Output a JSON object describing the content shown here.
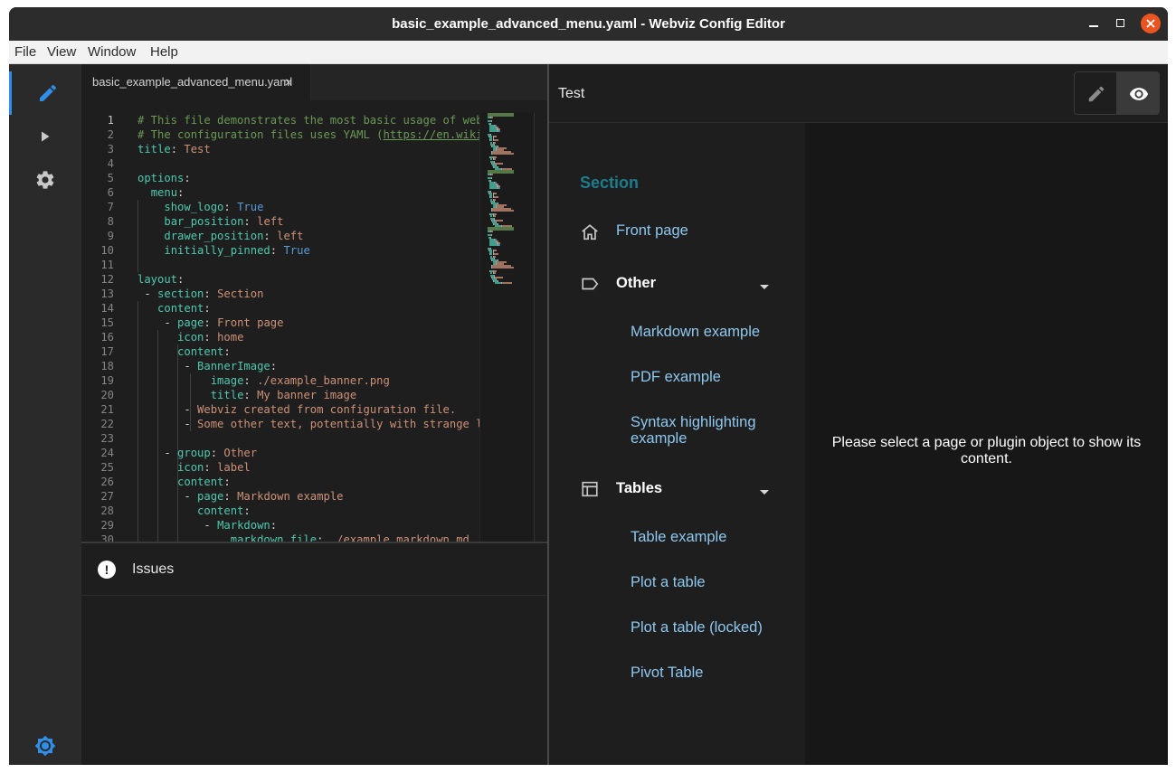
{
  "window": {
    "title": "basic_example_advanced_menu.yaml - Webviz Config Editor"
  },
  "menubar": {
    "items": [
      "File",
      "View",
      "Window",
      "Help"
    ]
  },
  "activity_bar": {
    "items": [
      {
        "name": "editor",
        "icon": "pencil-icon",
        "active": true
      },
      {
        "name": "play",
        "icon": "play-icon",
        "active": false
      },
      {
        "name": "settings",
        "icon": "gear-icon",
        "active": false
      },
      {
        "name": "theme",
        "icon": "brightness-icon",
        "active": false
      }
    ]
  },
  "editor": {
    "tab": {
      "label": "basic_example_advanced_menu.yaml",
      "close": "×"
    },
    "current_line": 1,
    "lines": [
      {
        "n": "1",
        "parts": [
          [
            "c",
            "# This file demonstrates the most basic usage of webv"
          ]
        ]
      },
      {
        "n": "2",
        "parts": [
          [
            "c",
            "# The configuration files uses YAML (https://en.wiki"
          ]
        ]
      },
      {
        "n": "3",
        "parts": [
          [
            "k",
            "title"
          ],
          [
            "p",
            ": "
          ],
          [
            "v",
            "Test"
          ]
        ]
      },
      {
        "n": "4",
        "parts": []
      },
      {
        "n": "5",
        "parts": [
          [
            "k",
            "options"
          ],
          [
            "p",
            ":"
          ]
        ]
      },
      {
        "n": "6",
        "parts": [
          [
            "p",
            "  "
          ],
          [
            "k",
            "menu"
          ],
          [
            "p",
            ":"
          ]
        ]
      },
      {
        "n": "7",
        "parts": [
          [
            "p",
            "    "
          ],
          [
            "k",
            "show_logo"
          ],
          [
            "p",
            ": "
          ],
          [
            "b",
            "True"
          ]
        ]
      },
      {
        "n": "8",
        "parts": [
          [
            "p",
            "    "
          ],
          [
            "k",
            "bar_position"
          ],
          [
            "p",
            ": "
          ],
          [
            "v",
            "left"
          ]
        ]
      },
      {
        "n": "9",
        "parts": [
          [
            "p",
            "    "
          ],
          [
            "k",
            "drawer_position"
          ],
          [
            "p",
            ": "
          ],
          [
            "v",
            "left"
          ]
        ]
      },
      {
        "n": "10",
        "parts": [
          [
            "p",
            "    "
          ],
          [
            "k",
            "initially_pinned"
          ],
          [
            "p",
            ": "
          ],
          [
            "b",
            "True"
          ]
        ]
      },
      {
        "n": "11",
        "parts": []
      },
      {
        "n": "12",
        "parts": [
          [
            "k",
            "layout"
          ],
          [
            "p",
            ":"
          ]
        ]
      },
      {
        "n": "13",
        "parts": [
          [
            "p",
            " - "
          ],
          [
            "k",
            "section"
          ],
          [
            "p",
            ": "
          ],
          [
            "v",
            "Section"
          ]
        ]
      },
      {
        "n": "14",
        "parts": [
          [
            "p",
            "   "
          ],
          [
            "k",
            "content"
          ],
          [
            "p",
            ":"
          ]
        ]
      },
      {
        "n": "15",
        "parts": [
          [
            "p",
            "    - "
          ],
          [
            "k",
            "page"
          ],
          [
            "p",
            ": "
          ],
          [
            "v",
            "Front page"
          ]
        ]
      },
      {
        "n": "16",
        "parts": [
          [
            "p",
            "      "
          ],
          [
            "k",
            "icon"
          ],
          [
            "p",
            ": "
          ],
          [
            "v",
            "home"
          ]
        ]
      },
      {
        "n": "17",
        "parts": [
          [
            "p",
            "      "
          ],
          [
            "k",
            "content"
          ],
          [
            "p",
            ":"
          ]
        ]
      },
      {
        "n": "18",
        "parts": [
          [
            "p",
            "       - "
          ],
          [
            "k",
            "BannerImage"
          ],
          [
            "p",
            ":"
          ]
        ]
      },
      {
        "n": "19",
        "parts": [
          [
            "p",
            "           "
          ],
          [
            "k",
            "image"
          ],
          [
            "p",
            ": "
          ],
          [
            "v",
            "./example_banner.png"
          ]
        ]
      },
      {
        "n": "20",
        "parts": [
          [
            "p",
            "           "
          ],
          [
            "k",
            "title"
          ],
          [
            "p",
            ": "
          ],
          [
            "v",
            "My banner image"
          ]
        ]
      },
      {
        "n": "21",
        "parts": [
          [
            "p",
            "       - "
          ],
          [
            "v",
            "Webviz created from configuration file."
          ]
        ]
      },
      {
        "n": "22",
        "parts": [
          [
            "p",
            "       - "
          ],
          [
            "v",
            "Some other text, potentially with strange le"
          ]
        ]
      },
      {
        "n": "23",
        "parts": []
      },
      {
        "n": "24",
        "parts": [
          [
            "p",
            "    - "
          ],
          [
            "k",
            "group"
          ],
          [
            "p",
            ": "
          ],
          [
            "v",
            "Other"
          ]
        ]
      },
      {
        "n": "25",
        "parts": [
          [
            "p",
            "      "
          ],
          [
            "k",
            "icon"
          ],
          [
            "p",
            ": "
          ],
          [
            "v",
            "label"
          ]
        ]
      },
      {
        "n": "26",
        "parts": [
          [
            "p",
            "      "
          ],
          [
            "k",
            "content"
          ],
          [
            "p",
            ":"
          ]
        ]
      },
      {
        "n": "27",
        "parts": [
          [
            "p",
            "       - "
          ],
          [
            "k",
            "page"
          ],
          [
            "p",
            ": "
          ],
          [
            "v",
            "Markdown example"
          ]
        ]
      },
      {
        "n": "28",
        "parts": [
          [
            "p",
            "         "
          ],
          [
            "k",
            "content"
          ],
          [
            "p",
            ":"
          ]
        ]
      },
      {
        "n": "29",
        "parts": [
          [
            "p",
            "          - "
          ],
          [
            "k",
            "Markdown"
          ],
          [
            "p",
            ":"
          ]
        ]
      },
      {
        "n": "30",
        "parts": [
          [
            "p",
            "              "
          ],
          [
            "k",
            "markdown_file"
          ],
          [
            "p",
            ": "
          ],
          [
            "v",
            "./example_markdown.md"
          ]
        ]
      }
    ]
  },
  "issues": {
    "icon": "!",
    "label": "Issues"
  },
  "preview": {
    "title": "Test",
    "edit_icon": "pencil-icon",
    "view_icon": "eye-icon",
    "section_title": "Section",
    "front_page": {
      "label": "Front page",
      "icon": "home-icon"
    },
    "group_other": {
      "label": "Other",
      "icon": "label-icon",
      "pages": [
        "Markdown example",
        "PDF example",
        "Syntax highlighting example"
      ]
    },
    "group_tables": {
      "label": "Tables",
      "icon": "table-icon",
      "pages": [
        "Table example",
        "Plot a table",
        "Plot a table (locked)",
        "Pivot Table"
      ]
    },
    "empty_message": "Please select a page or plugin object to show its content."
  },
  "colors": {
    "accent": "#2f8ee8",
    "section": "#1e7d8c",
    "link": "#8ec8f0",
    "close": "#e95420"
  }
}
